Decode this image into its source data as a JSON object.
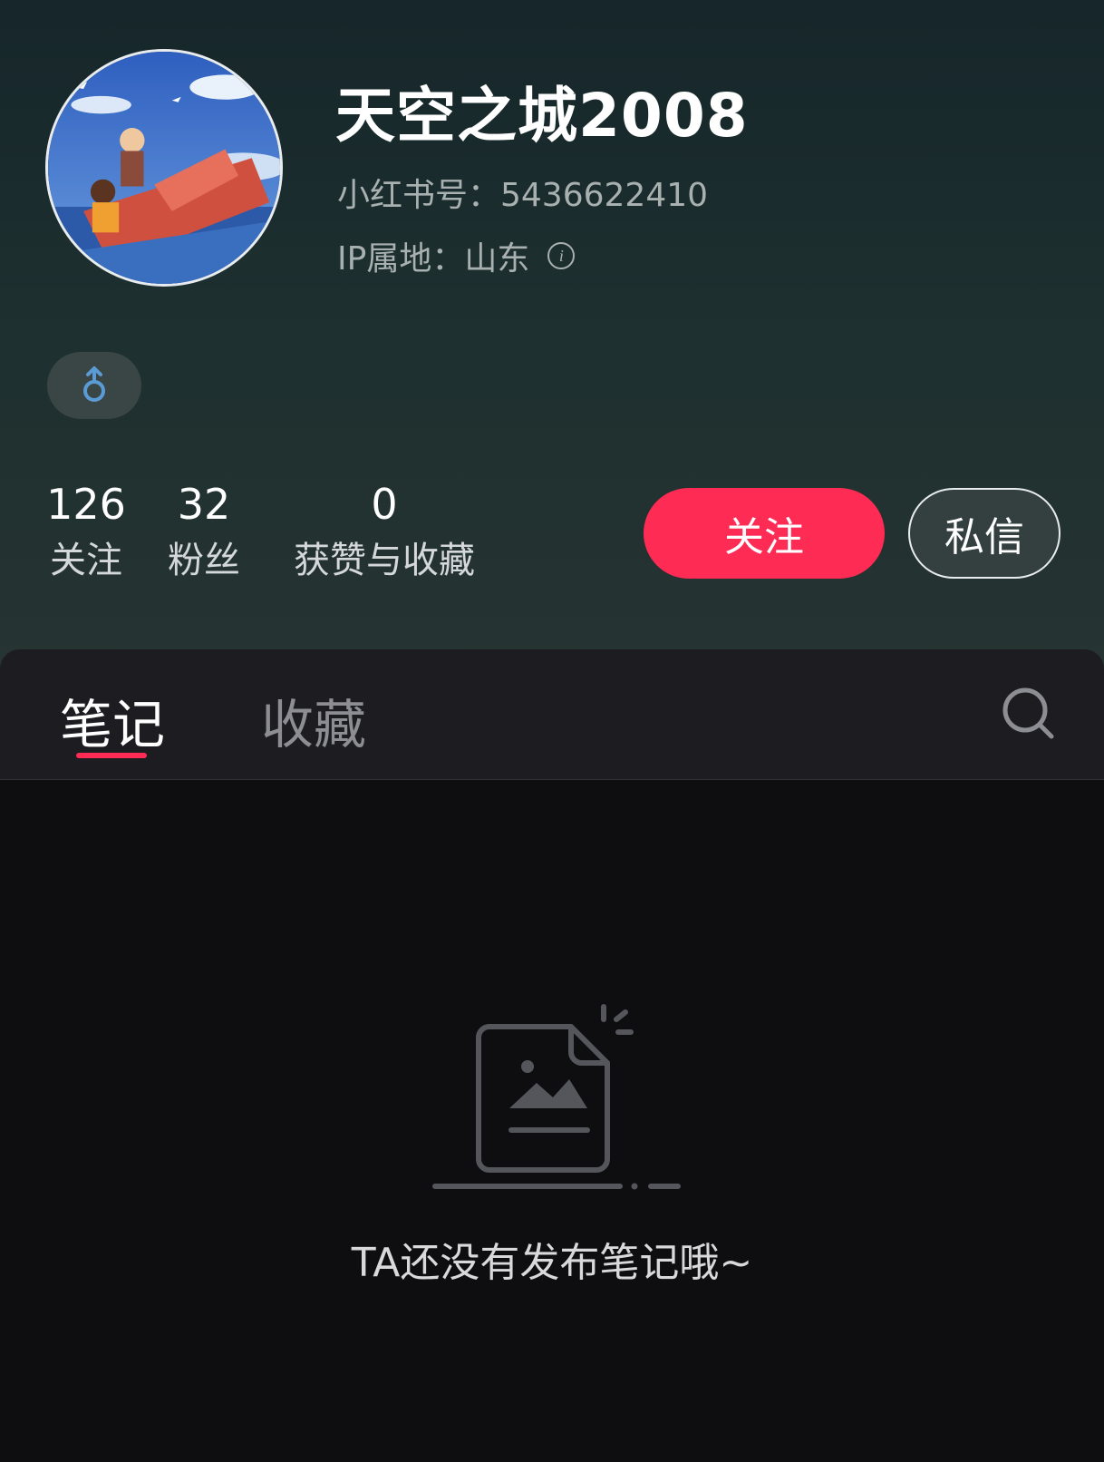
{
  "profile": {
    "nickname": "天空之城2008",
    "user_id": "小红书号：5436622410",
    "ip_location": "IP属地：山东",
    "info_icon": "i",
    "gender_icon": "male-symbol",
    "gender_icon_color": "#5b9bd5"
  },
  "stats": [
    {
      "value": "126",
      "label": "关注"
    },
    {
      "value": "32",
      "label": "粉丝"
    },
    {
      "value": "0",
      "label": "获赞与收藏"
    }
  ],
  "actions": {
    "follow_label": "关注",
    "message_label": "私信"
  },
  "tabs": [
    {
      "label": "笔记",
      "active": true
    },
    {
      "label": "收藏",
      "active": false
    }
  ],
  "empty_state": {
    "text": "TA还没有发布笔记哦~"
  },
  "colors": {
    "accent": "#fe2c55",
    "background": "#0e0e10",
    "tab_bar": "#1c1c21"
  }
}
